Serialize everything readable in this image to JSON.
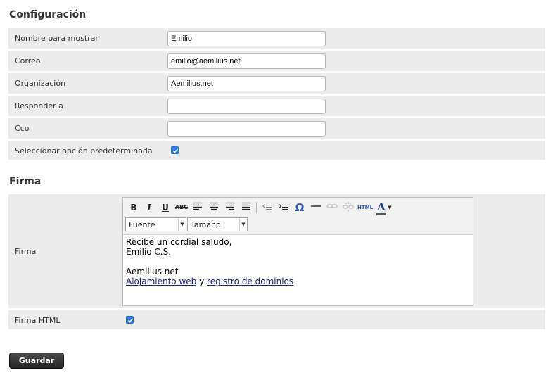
{
  "config": {
    "title": "Configuración",
    "fields": [
      {
        "label": "Nombre para mostrar",
        "value": "Emilio",
        "placeholder": ""
      },
      {
        "label": "Correo",
        "value": "emilio@aemilius.net",
        "placeholder": ""
      },
      {
        "label": "Organización",
        "value": "Aemilius.net",
        "placeholder": ""
      },
      {
        "label": "Responder a",
        "value": "",
        "placeholder": ""
      },
      {
        "label": "Cco",
        "value": "",
        "placeholder": ""
      }
    ],
    "default_option": {
      "label": "Seleccionar opción predeterminada",
      "checked": true
    }
  },
  "signature": {
    "title": "Firma",
    "label": "Firma",
    "toolbar": {
      "font_select": "Fuente",
      "size_select": "Tamaño",
      "html_label": "HTML"
    },
    "content": {
      "line1": "Recibe un cordial saludo,",
      "line2": "Emilio C.S.",
      "line3": "Aemilius.net",
      "link1": "Alojamiento web",
      "connector": "y",
      "link2": "registro de dominios"
    },
    "html_option": {
      "label": "Firma HTML",
      "checked": true
    }
  },
  "save_button": "Guardar",
  "colors": {
    "accent": "#2b7de9",
    "row_bg": "#ececec",
    "button_bg": "#333333"
  }
}
